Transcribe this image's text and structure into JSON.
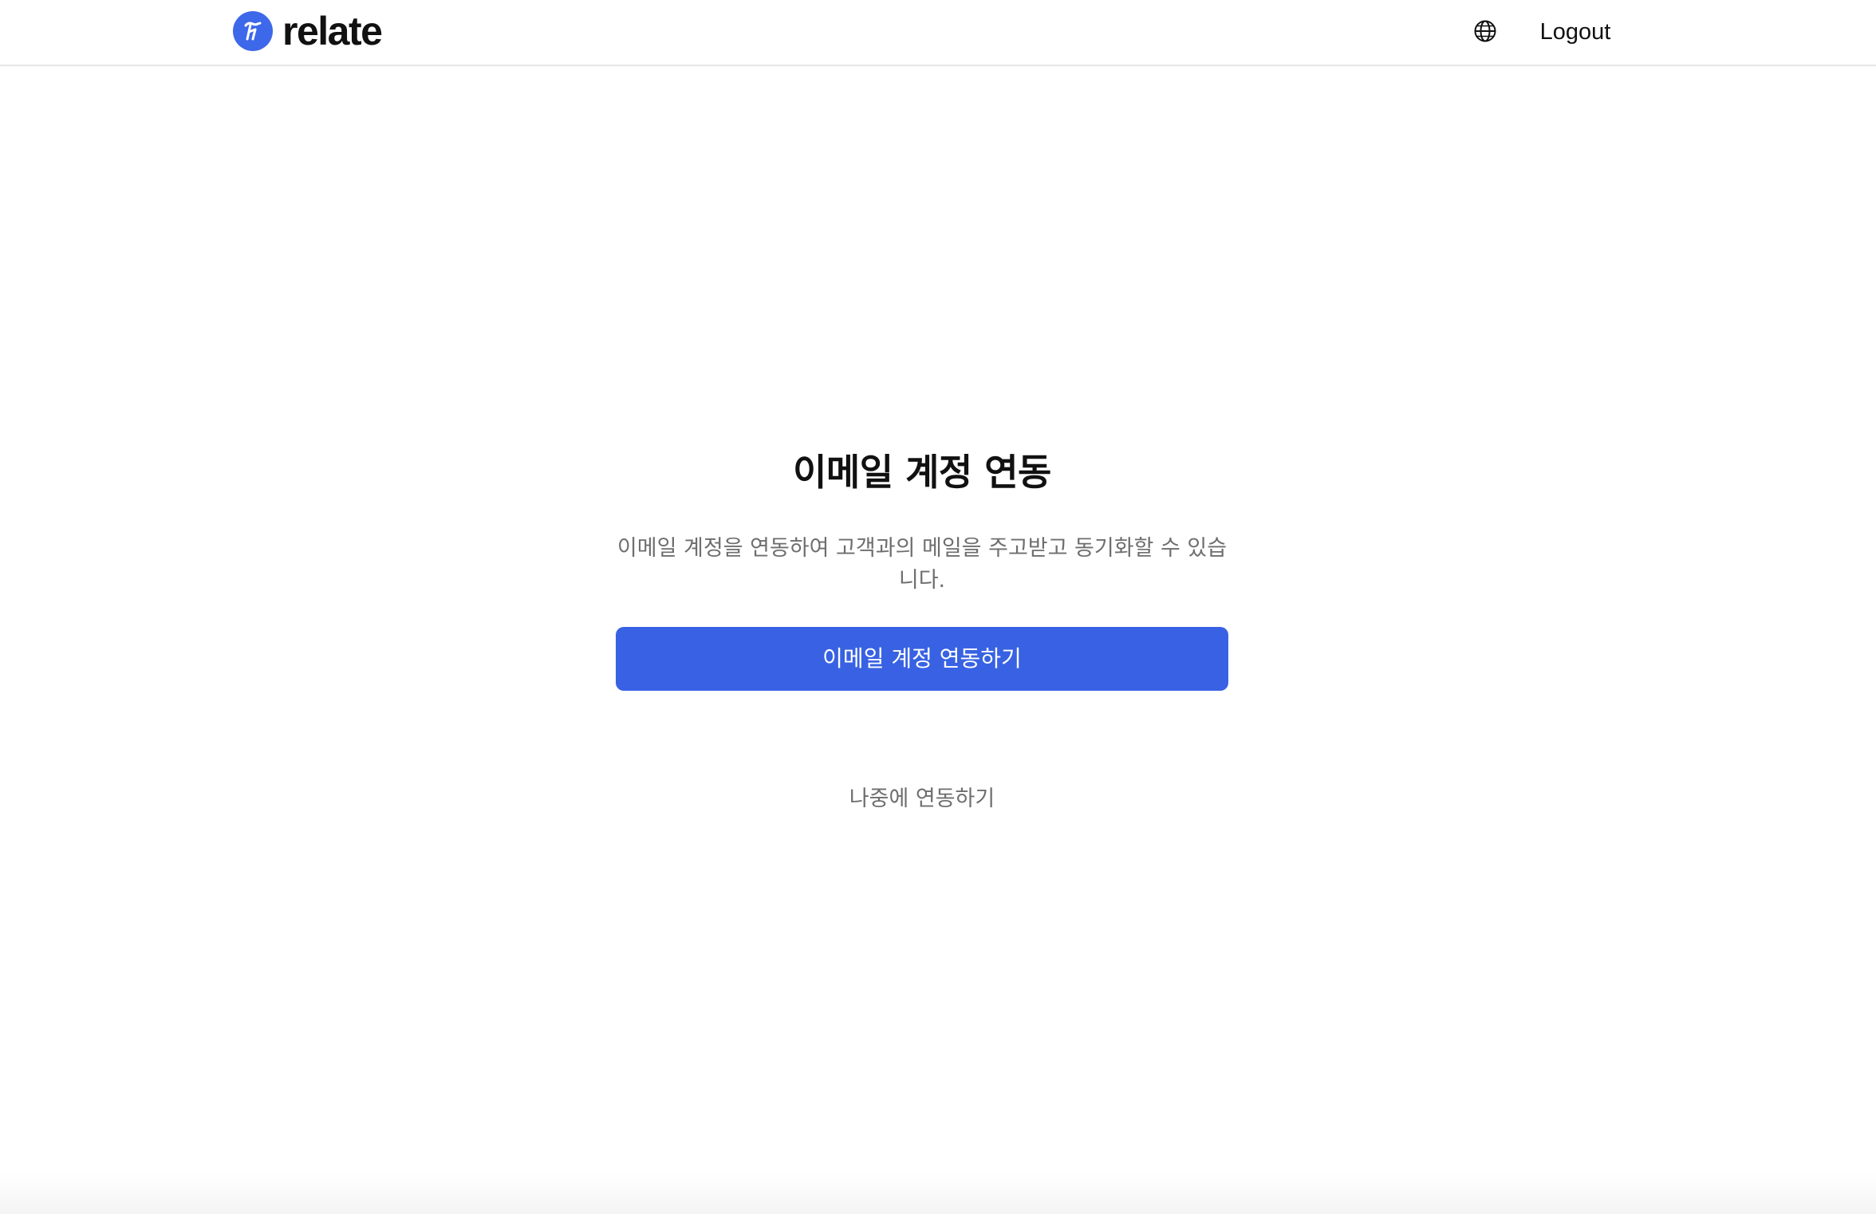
{
  "header": {
    "brand_name": "relate",
    "brand_color": "#3e68ea",
    "logo_icon": "relate-logo-icon",
    "language_icon": "globe-icon",
    "logout_label": "Logout"
  },
  "main": {
    "title": "이메일 계정 연동",
    "description": "이메일 계정을 연동하여 고객과의 메일을 주고받고 동기화할 수 있습니다.",
    "connect_button_label": "이메일 계정 연동하기",
    "connect_button_color": "#3862e3",
    "later_link_label": "나중에 연동하기"
  }
}
